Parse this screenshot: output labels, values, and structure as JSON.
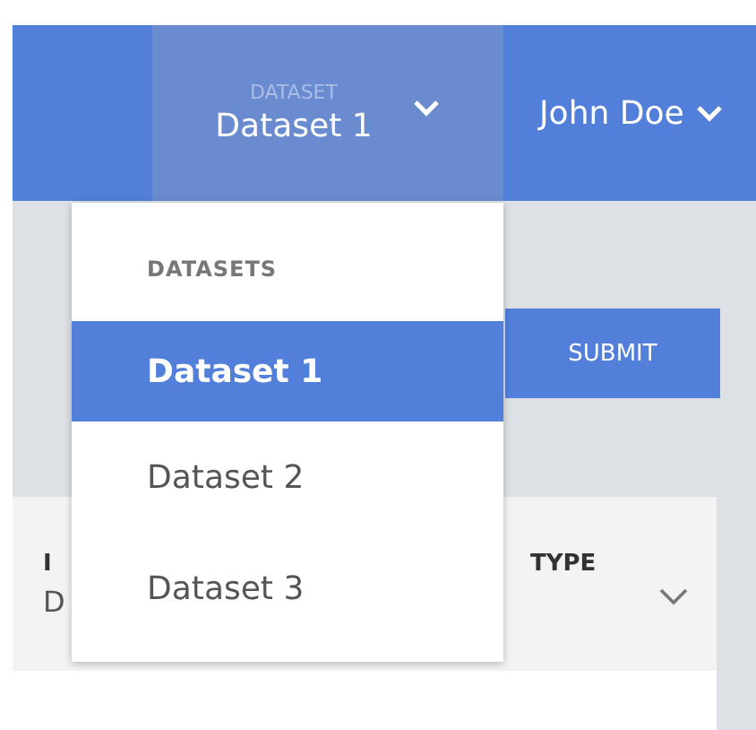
{
  "header": {
    "dataset_selector": {
      "label": "DATASET",
      "value": "Dataset 1",
      "expanded": true
    },
    "user_menu": {
      "name": "John Doe"
    }
  },
  "dropdown": {
    "heading": "DATASETS",
    "items": [
      {
        "label": "Dataset 1",
        "selected": true
      },
      {
        "label": "Dataset 2",
        "selected": false
      },
      {
        "label": "Dataset 3",
        "selected": false
      }
    ]
  },
  "submit_button": "SUBMIT",
  "fields": [
    {
      "label": "I",
      "value": "D"
    },
    {
      "label": "TYPE"
    }
  ]
}
